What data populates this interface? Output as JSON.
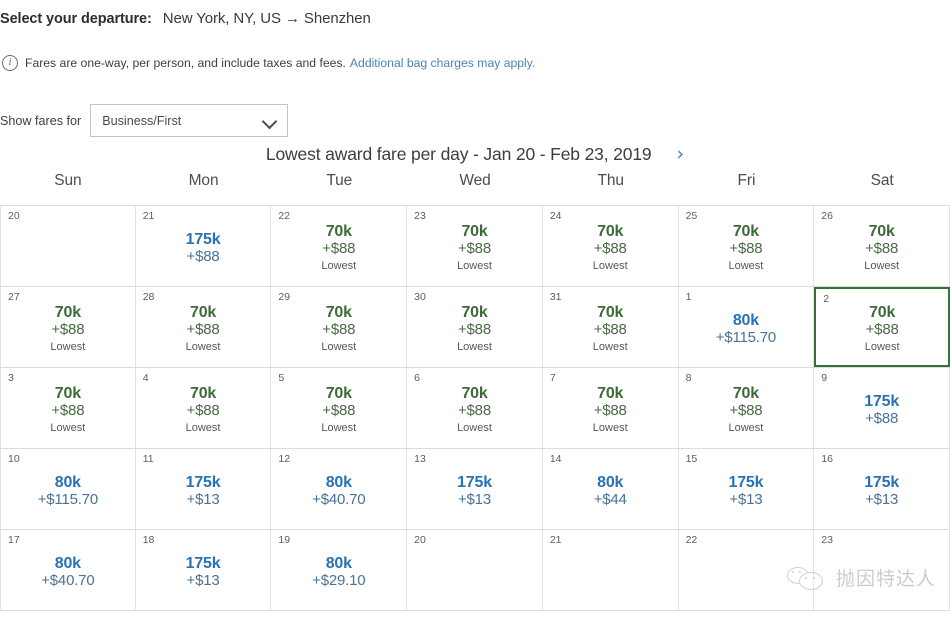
{
  "header": {
    "departure_label": "Select your departure:",
    "route": "New York, NY, US → Shenzhen"
  },
  "fare_note": {
    "icon": "info-icon",
    "text": "Fares are one-way, per person, and include taxes and fees.",
    "link_text": "Additional bag charges may apply."
  },
  "fares_filter": {
    "label": "Show fares for",
    "selected": "Business/First",
    "options": [
      "Business/First"
    ],
    "chevron_icon": "chevron-down-icon"
  },
  "calendar": {
    "title": "Lowest award fare per day - Jan 20 - Feb 23, 2019",
    "next_label": "›",
    "weekdays": [
      "Sun",
      "Mon",
      "Tue",
      "Wed",
      "Thu",
      "Fri",
      "Sat"
    ],
    "lowest_flag": "Lowest",
    "colors": {
      "lowest": "#3d6b38",
      "normal": "#2a71b5",
      "selected_border": "#35703d",
      "link": "#4a84b8"
    },
    "rows": [
      [
        {
          "day": "20",
          "miles": "",
          "tax": "",
          "flag": "",
          "lowest": false,
          "empty": true,
          "selected": false
        },
        {
          "day": "21",
          "miles": "175k",
          "tax": "+$88",
          "flag": "",
          "lowest": false,
          "empty": false,
          "selected": false
        },
        {
          "day": "22",
          "miles": "70k",
          "tax": "+$88",
          "flag": "Lowest",
          "lowest": true,
          "empty": false,
          "selected": false
        },
        {
          "day": "23",
          "miles": "70k",
          "tax": "+$88",
          "flag": "Lowest",
          "lowest": true,
          "empty": false,
          "selected": false
        },
        {
          "day": "24",
          "miles": "70k",
          "tax": "+$88",
          "flag": "Lowest",
          "lowest": true,
          "empty": false,
          "selected": false
        },
        {
          "day": "25",
          "miles": "70k",
          "tax": "+$88",
          "flag": "Lowest",
          "lowest": true,
          "empty": false,
          "selected": false
        },
        {
          "day": "26",
          "miles": "70k",
          "tax": "+$88",
          "flag": "Lowest",
          "lowest": true,
          "empty": false,
          "selected": false
        }
      ],
      [
        {
          "day": "27",
          "miles": "70k",
          "tax": "+$88",
          "flag": "Lowest",
          "lowest": true,
          "empty": false,
          "selected": false
        },
        {
          "day": "28",
          "miles": "70k",
          "tax": "+$88",
          "flag": "Lowest",
          "lowest": true,
          "empty": false,
          "selected": false
        },
        {
          "day": "29",
          "miles": "70k",
          "tax": "+$88",
          "flag": "Lowest",
          "lowest": true,
          "empty": false,
          "selected": false
        },
        {
          "day": "30",
          "miles": "70k",
          "tax": "+$88",
          "flag": "Lowest",
          "lowest": true,
          "empty": false,
          "selected": false
        },
        {
          "day": "31",
          "miles": "70k",
          "tax": "+$88",
          "flag": "Lowest",
          "lowest": true,
          "empty": false,
          "selected": false
        },
        {
          "day": "1",
          "miles": "80k",
          "tax": "+$115.70",
          "flag": "",
          "lowest": false,
          "empty": false,
          "selected": false
        },
        {
          "day": "2",
          "miles": "70k",
          "tax": "+$88",
          "flag": "Lowest",
          "lowest": true,
          "empty": false,
          "selected": true
        }
      ],
      [
        {
          "day": "3",
          "miles": "70k",
          "tax": "+$88",
          "flag": "Lowest",
          "lowest": true,
          "empty": false,
          "selected": false
        },
        {
          "day": "4",
          "miles": "70k",
          "tax": "+$88",
          "flag": "Lowest",
          "lowest": true,
          "empty": false,
          "selected": false
        },
        {
          "day": "5",
          "miles": "70k",
          "tax": "+$88",
          "flag": "Lowest",
          "lowest": true,
          "empty": false,
          "selected": false
        },
        {
          "day": "6",
          "miles": "70k",
          "tax": "+$88",
          "flag": "Lowest",
          "lowest": true,
          "empty": false,
          "selected": false
        },
        {
          "day": "7",
          "miles": "70k",
          "tax": "+$88",
          "flag": "Lowest",
          "lowest": true,
          "empty": false,
          "selected": false
        },
        {
          "day": "8",
          "miles": "70k",
          "tax": "+$88",
          "flag": "Lowest",
          "lowest": true,
          "empty": false,
          "selected": false
        },
        {
          "day": "9",
          "miles": "175k",
          "tax": "+$88",
          "flag": "",
          "lowest": false,
          "empty": false,
          "selected": false
        }
      ],
      [
        {
          "day": "10",
          "miles": "80k",
          "tax": "+$115.70",
          "flag": "",
          "lowest": false,
          "empty": false,
          "selected": false
        },
        {
          "day": "11",
          "miles": "175k",
          "tax": "+$13",
          "flag": "",
          "lowest": false,
          "empty": false,
          "selected": false
        },
        {
          "day": "12",
          "miles": "80k",
          "tax": "+$40.70",
          "flag": "",
          "lowest": false,
          "empty": false,
          "selected": false
        },
        {
          "day": "13",
          "miles": "175k",
          "tax": "+$13",
          "flag": "",
          "lowest": false,
          "empty": false,
          "selected": false
        },
        {
          "day": "14",
          "miles": "80k",
          "tax": "+$44",
          "flag": "",
          "lowest": false,
          "empty": false,
          "selected": false
        },
        {
          "day": "15",
          "miles": "175k",
          "tax": "+$13",
          "flag": "",
          "lowest": false,
          "empty": false,
          "selected": false
        },
        {
          "day": "16",
          "miles": "175k",
          "tax": "+$13",
          "flag": "",
          "lowest": false,
          "empty": false,
          "selected": false
        }
      ],
      [
        {
          "day": "17",
          "miles": "80k",
          "tax": "+$40.70",
          "flag": "",
          "lowest": false,
          "empty": false,
          "selected": false
        },
        {
          "day": "18",
          "miles": "175k",
          "tax": "+$13",
          "flag": "",
          "lowest": false,
          "empty": false,
          "selected": false
        },
        {
          "day": "19",
          "miles": "80k",
          "tax": "+$29.10",
          "flag": "",
          "lowest": false,
          "empty": false,
          "selected": false
        },
        {
          "day": "20",
          "miles": "",
          "tax": "",
          "flag": "",
          "lowest": false,
          "empty": true,
          "selected": false
        },
        {
          "day": "21",
          "miles": "",
          "tax": "",
          "flag": "",
          "lowest": false,
          "empty": true,
          "selected": false
        },
        {
          "day": "22",
          "miles": "",
          "tax": "",
          "flag": "",
          "lowest": false,
          "empty": true,
          "selected": false
        },
        {
          "day": "23",
          "miles": "",
          "tax": "",
          "flag": "",
          "lowest": false,
          "empty": true,
          "selected": false
        }
      ]
    ]
  },
  "watermark": {
    "text": "抛因特达人",
    "icon": "wechat-icon"
  }
}
